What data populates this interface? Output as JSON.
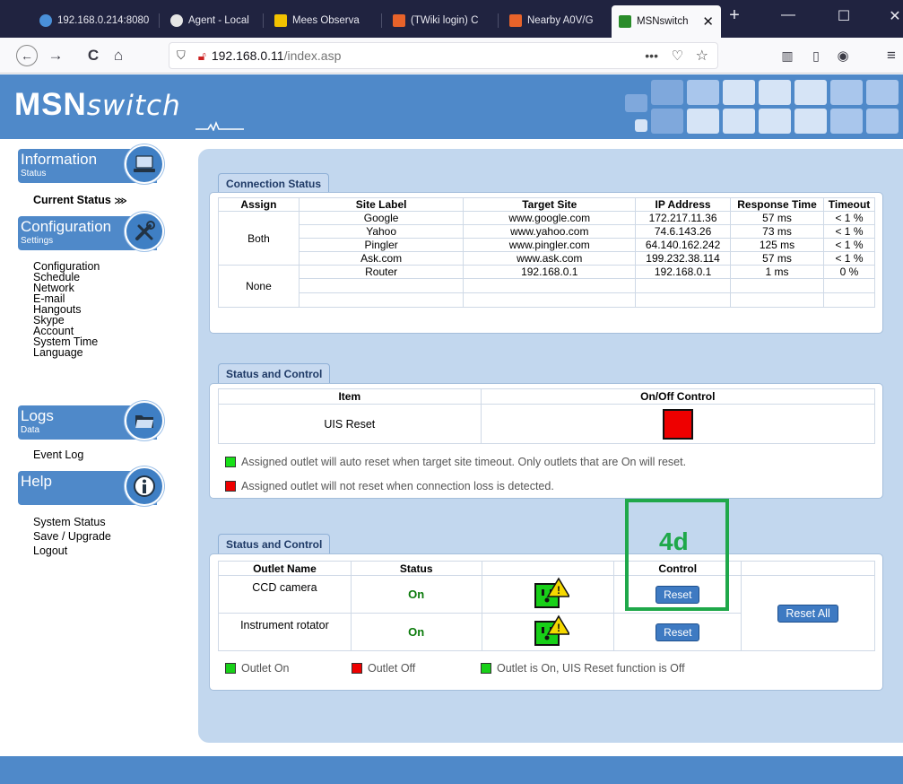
{
  "browser": {
    "tabs": [
      {
        "label": "192.168.0.214:8080",
        "fav": "#4a90d9"
      },
      {
        "label": "Agent - Local",
        "fav": "#f0f0f0"
      },
      {
        "label": "Mees Observa",
        "fav": "#f2c200"
      },
      {
        "label": "(TWiki login) C",
        "fav": "#e8632a"
      },
      {
        "label": "Nearby A0V/G",
        "fav": "#e8632a"
      },
      {
        "label": "MSNswitch",
        "fav": "#2a8c2a"
      }
    ],
    "url_host": "192.168.0.11",
    "url_path": "/index.asp",
    "icons": [
      "back-icon",
      "forward-icon",
      "reload-icon",
      "home-icon",
      "shield-icon",
      "insecure-lock-icon",
      "more-icon",
      "pocket-icon",
      "bookmark-star-icon",
      "library-icon",
      "sidebar-icon",
      "account-icon",
      "menu-icon"
    ]
  },
  "header": {
    "logo_bold": "MSN",
    "logo_italic": "switch"
  },
  "sidebar": {
    "information": {
      "title": "Information",
      "sub": "Status"
    },
    "current_status": "Current Status",
    "configuration": {
      "title": "Configuration",
      "sub": "Settings"
    },
    "config_links": [
      "Configuration",
      "Schedule",
      "Network",
      "E-mail",
      "Hangouts",
      "Skype",
      "Account",
      "System Time",
      "Language"
    ],
    "logs": {
      "title": "Logs",
      "sub": "Data"
    },
    "log_links": [
      "Event Log"
    ],
    "help": {
      "title": "Help",
      "sub": ""
    },
    "help_links": [
      "System Status",
      "Save / Upgrade",
      "Logout"
    ]
  },
  "connection": {
    "title": "Connection Status",
    "headers": [
      "Assign",
      "Site Label",
      "Target Site",
      "IP Address",
      "Response Time",
      "Timeout"
    ],
    "groups": [
      {
        "assign": "Both",
        "rows": [
          [
            "Google",
            "www.google.com",
            "172.217.11.36",
            "57 ms",
            "< 1 %"
          ],
          [
            "Yahoo",
            "www.yahoo.com",
            "74.6.143.26",
            "73 ms",
            "< 1 %"
          ],
          [
            "Pingler",
            "www.pingler.com",
            "64.140.162.242",
            "125 ms",
            "< 1 %"
          ],
          [
            "Ask.com",
            "www.ask.com",
            "199.232.38.114",
            "57 ms",
            "< 1 %"
          ]
        ]
      },
      {
        "assign": "None",
        "rows": [
          [
            "Router",
            "192.168.0.1",
            "192.168.0.1",
            "1 ms",
            "0 %"
          ],
          [
            "",
            "",
            "",
            "",
            ""
          ],
          [
            "",
            "",
            "",
            "",
            ""
          ]
        ]
      }
    ]
  },
  "uis": {
    "title": "Status and Control",
    "col_item": "Item",
    "col_control": "On/Off Control",
    "item": "UIS Reset",
    "control_color": "#ee0000",
    "legend_green": "Assigned outlet will auto reset when target site timeout. Only outlets that are On will reset.",
    "legend_red": "Assigned outlet will not reset when connection loss is detected."
  },
  "outlets": {
    "title": "Status and Control",
    "col_name": "Outlet Name",
    "col_status": "Status",
    "col_control": "Control",
    "rows": [
      {
        "name": "CCD camera",
        "status": "On",
        "button": "Reset"
      },
      {
        "name": "Instrument rotator",
        "status": "On",
        "button": "Reset"
      }
    ],
    "reset_all": "Reset All",
    "legend_on": "Outlet On",
    "legend_off": "Outlet Off",
    "legend_uis_off": "Outlet is On, UIS Reset function is Off"
  },
  "annotation": {
    "label": "4d",
    "color": "#1fa84a"
  }
}
